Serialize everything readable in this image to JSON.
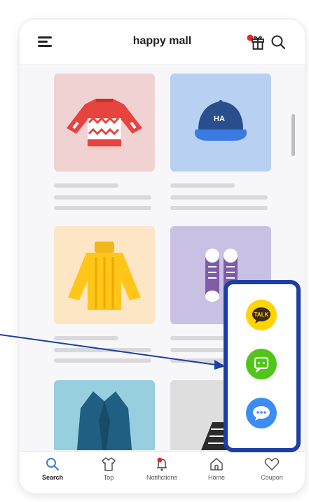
{
  "header": {
    "title": "happy mall",
    "gift_badge_color": "#e8252b"
  },
  "products": [
    {
      "name": "sweater",
      "bg": "#f1d2d3"
    },
    {
      "name": "cap",
      "bg": "#b8d1f2",
      "cap_text": "HA"
    },
    {
      "name": "knit-sweater",
      "bg": "#fde6c5"
    },
    {
      "name": "sneakers",
      "bg": "#c9c1e3"
    },
    {
      "name": "coat",
      "bg": "#98cfdf"
    },
    {
      "name": "boots",
      "bg": "#dedede"
    }
  ],
  "tabs": [
    {
      "label": "Search",
      "icon": "search-icon",
      "active": true
    },
    {
      "label": "Top",
      "icon": "shirt-icon"
    },
    {
      "label": "Notifictions",
      "icon": "bell-icon"
    },
    {
      "label": "Home",
      "icon": "home-icon"
    },
    {
      "label": "Coupon",
      "icon": "heart-icon"
    }
  ],
  "floating_buttons": [
    {
      "name": "kakaotalk",
      "label": "TALK",
      "color": "#ffd400"
    },
    {
      "name": "chat",
      "color": "#52c41a"
    },
    {
      "name": "messenger",
      "color": "#3c8cf6"
    }
  ],
  "highlight_color": "#1b3fa6"
}
